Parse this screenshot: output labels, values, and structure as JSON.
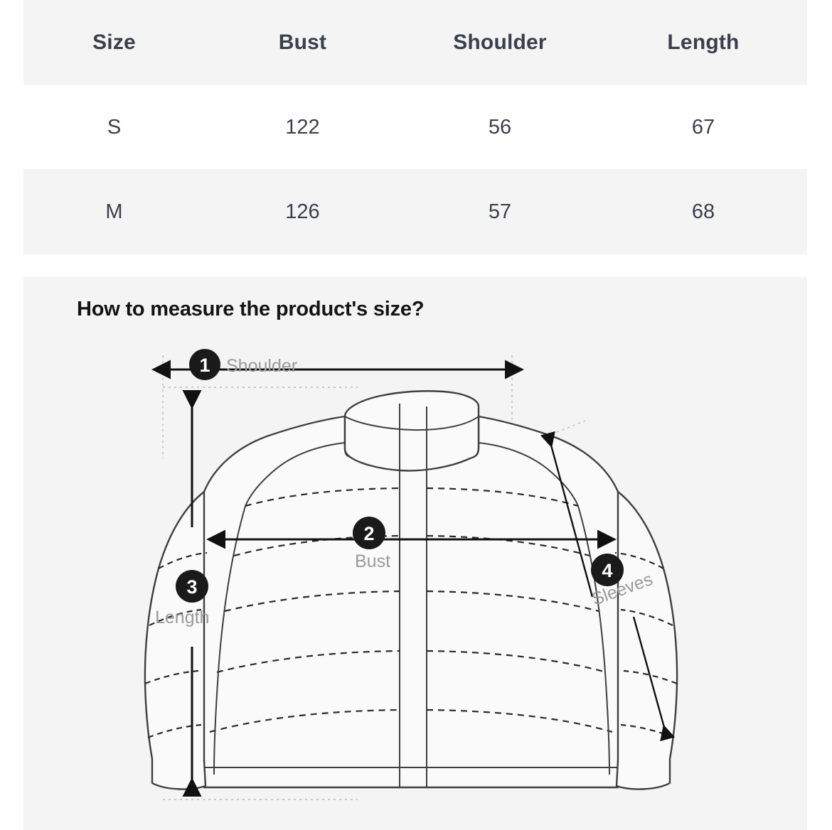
{
  "table": {
    "columns": [
      "Size",
      "Bust",
      "Shoulder",
      "Length"
    ],
    "rows": [
      {
        "size": "S",
        "bust": "122",
        "shoulder": "56",
        "length": "67"
      },
      {
        "size": "M",
        "bust": "126",
        "shoulder": "57",
        "length": "68"
      }
    ]
  },
  "diagram": {
    "title": "How to measure the product's size?",
    "measurements": [
      {
        "badge": "1",
        "label": "Shoulder"
      },
      {
        "badge": "2",
        "label": "Bust"
      },
      {
        "badge": "3",
        "label": "Length"
      },
      {
        "badge": "4",
        "label": "Sleeves"
      }
    ]
  },
  "colors": {
    "row_gray": "#f4f4f4",
    "row_white": "#ffffff",
    "text_dark": "#3a3f4c",
    "title_black": "#141414",
    "label_gray": "#9a9a9a",
    "badge_black": "#1a1a1a",
    "garment_line": "#3f3f3f"
  },
  "chart_data": {
    "type": "table",
    "title": "Size Chart",
    "categories": [
      "S",
      "M"
    ],
    "columns": [
      "Size",
      "Bust",
      "Shoulder",
      "Length"
    ],
    "series": [
      {
        "name": "Bust",
        "values": [
          122,
          126
        ]
      },
      {
        "name": "Shoulder",
        "values": [
          56,
          57
        ]
      },
      {
        "name": "Length",
        "values": [
          67,
          68
        ]
      }
    ]
  }
}
